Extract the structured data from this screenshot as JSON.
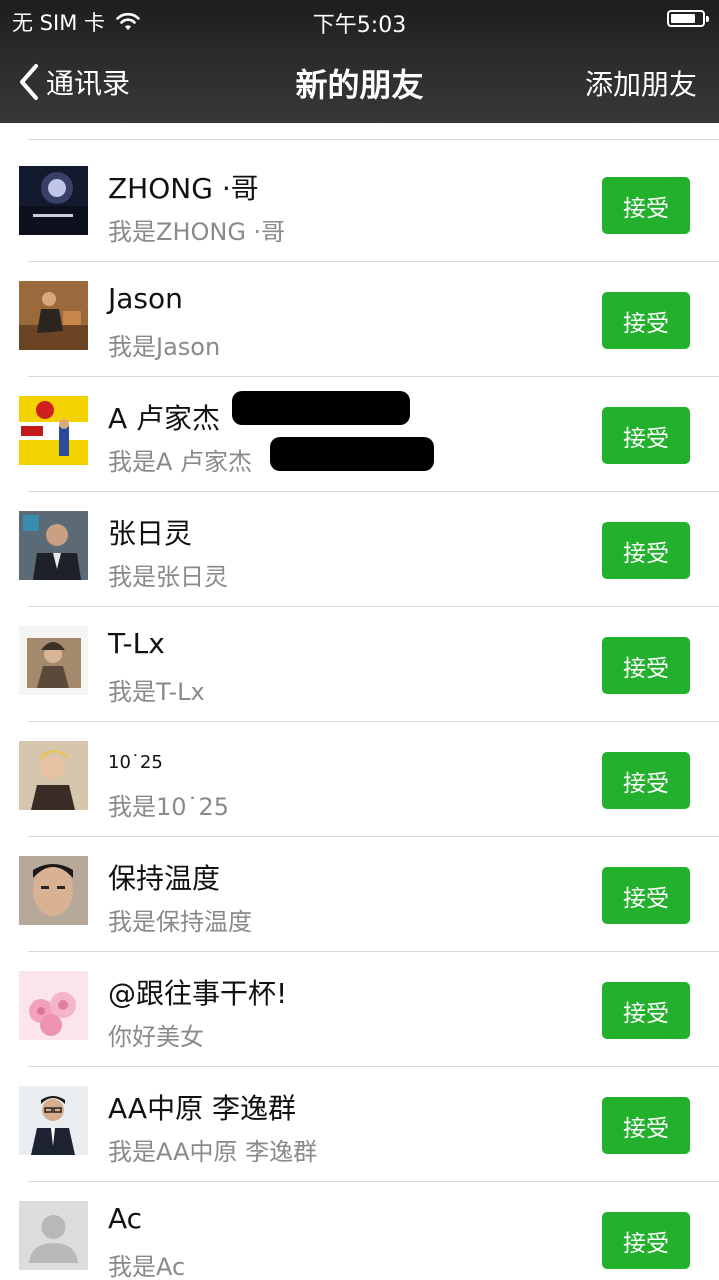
{
  "status_bar": {
    "carrier": "无 SIM 卡",
    "time": "下午5:03"
  },
  "nav": {
    "back_label": "通讯录",
    "title": "新的朋友",
    "action_label": "添加朋友"
  },
  "requests": [
    {
      "name": "ZHONG ·哥",
      "message": "我是ZHONG ·哥",
      "button": "接受",
      "avatar_icon": "night-photo-avatar"
    },
    {
      "name": "Jason",
      "message": "我是Jason",
      "button": "接受",
      "avatar_icon": "person-seated-avatar"
    },
    {
      "name": "A 卢家杰",
      "message": "我是A 卢家杰",
      "button": "接受",
      "avatar_icon": "shop-sign-avatar"
    },
    {
      "name": "张日灵",
      "message": "我是张日灵",
      "button": "接受",
      "avatar_icon": "person-suit-avatar"
    },
    {
      "name": "T-Lx",
      "message": "我是T-Lx",
      "button": "接受",
      "avatar_icon": "girl-photo-avatar"
    },
    {
      "name": "10˙25",
      "message": "我是10˙25",
      "button": "接受",
      "avatar_icon": "man-blond-avatar"
    },
    {
      "name": "保持温度",
      "message": "我是保持温度",
      "button": "接受",
      "avatar_icon": "man-face-avatar"
    },
    {
      "name": "@跟往事干杯!",
      "message": "你好美女",
      "button": "接受",
      "avatar_icon": "pink-roses-avatar"
    },
    {
      "name": "AA中原 李逸群",
      "message": "我是AA中原 李逸群",
      "button": "接受",
      "avatar_icon": "man-glasses-avatar"
    },
    {
      "name": "Ac",
      "message": "我是Ac",
      "button": "接受",
      "avatar_icon": "default-person-avatar"
    }
  ],
  "colors": {
    "accept_green": "#23b02c",
    "navbar_dark": "#2f2f2f",
    "subtitle_gray": "#8a8a8a"
  }
}
